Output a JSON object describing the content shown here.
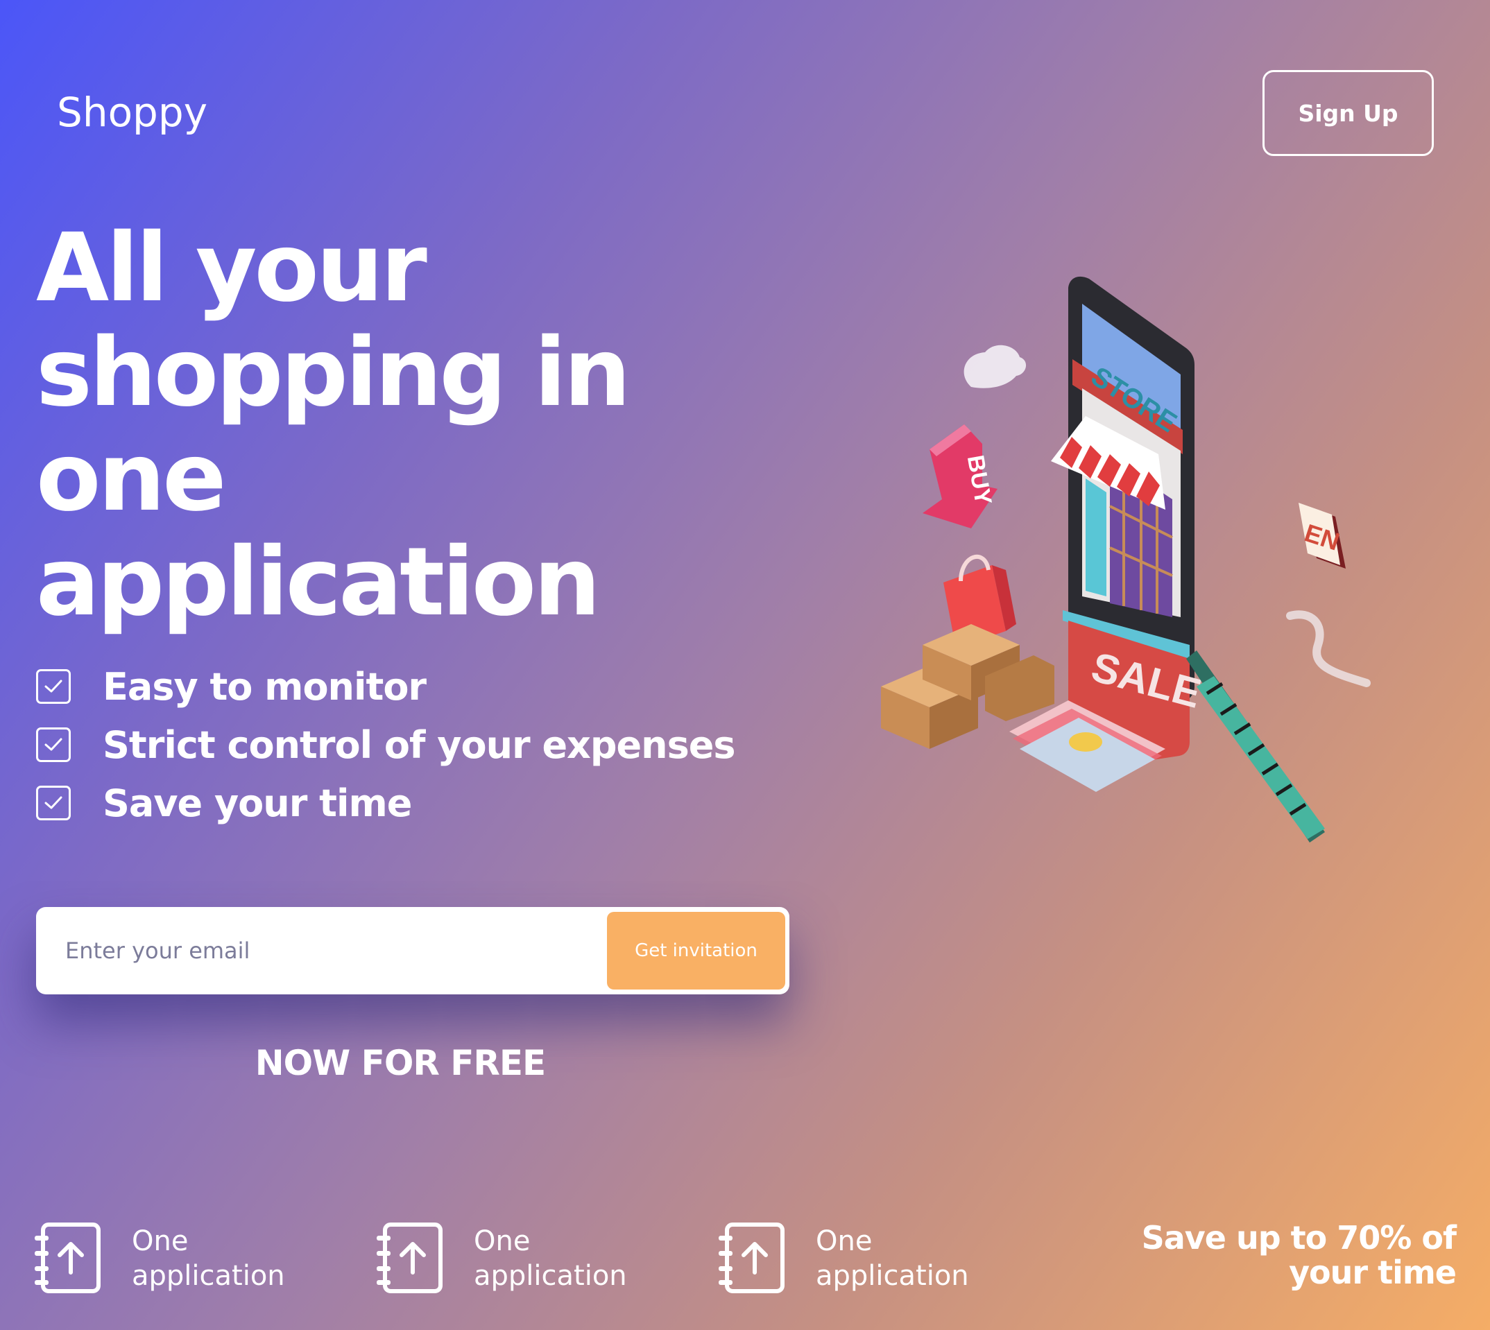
{
  "brand": {
    "name": "Shoppy"
  },
  "header": {
    "signup_label": "Sign Up"
  },
  "hero": {
    "headline": "All your shopping in one application",
    "features": [
      {
        "label": "Easy to monitor",
        "checked": true
      },
      {
        "label": "Strict control of your expenses",
        "checked": true
      },
      {
        "label": "Save your time",
        "checked": true
      }
    ]
  },
  "signup_form": {
    "email_placeholder": "Enter your email",
    "email_value": "",
    "button_label": "Get invitation",
    "tagline": "NOW FOR FREE"
  },
  "illustration": {
    "signs": {
      "store": "STORE",
      "sale": "SALE",
      "buy": "BUY",
      "open": "EN"
    }
  },
  "stats": [
    {
      "icon": "upload-document-icon",
      "label": "One application"
    },
    {
      "icon": "upload-document-icon",
      "label": "One application"
    },
    {
      "icon": "upload-document-icon",
      "label": "One application"
    }
  ],
  "savings_text": "Save up to 70% of your time",
  "colors": {
    "gradient_start": "#4b56f8",
    "gradient_mid": "#a17fa8",
    "gradient_end": "#f5ad66",
    "accent_button": "#f9b064",
    "text": "#ffffff"
  }
}
